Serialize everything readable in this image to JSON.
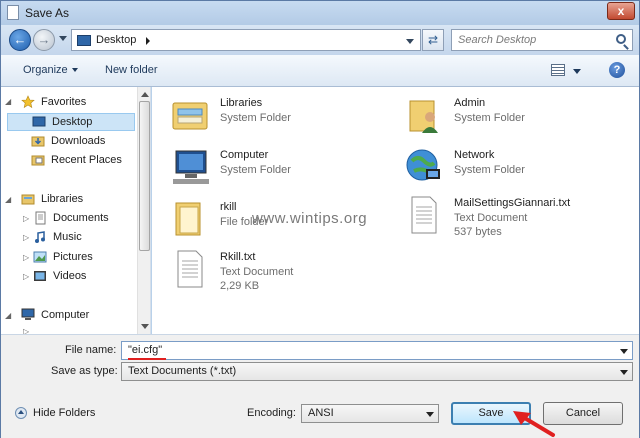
{
  "window": {
    "title": "Save As",
    "close_label": "x"
  },
  "nav": {
    "back_label": "←",
    "forward_label": "→",
    "location": "Desktop",
    "refresh_label": "⇄",
    "search_placeholder": "Search Desktop"
  },
  "toolbar": {
    "organize_label": "Organize",
    "new_folder_label": "New folder",
    "help_label": "?"
  },
  "sidebar": {
    "favorites_label": "Favorites",
    "favorites": [
      {
        "label": "Desktop",
        "icon": "desktop-icon",
        "selected": true
      },
      {
        "label": "Downloads",
        "icon": "downloads-folder-icon"
      },
      {
        "label": "Recent Places",
        "icon": "recent-places-icon"
      }
    ],
    "libraries_label": "Libraries",
    "libraries": [
      {
        "label": "Documents",
        "icon": "documents-icon"
      },
      {
        "label": "Music",
        "icon": "music-icon"
      },
      {
        "label": "Pictures",
        "icon": "pictures-icon"
      },
      {
        "label": "Videos",
        "icon": "videos-icon"
      }
    ],
    "computer_label": "Computer"
  },
  "files": [
    {
      "name": "Libraries",
      "type": "System Folder",
      "size": "",
      "icon": "libraries-icon"
    },
    {
      "name": "Admin",
      "type": "System Folder",
      "size": "",
      "icon": "user-folder-icon"
    },
    {
      "name": "Computer",
      "type": "System Folder",
      "size": "",
      "icon": "computer-icon"
    },
    {
      "name": "Network",
      "type": "System Folder",
      "size": "",
      "icon": "network-icon"
    },
    {
      "name": "rkill",
      "type": "File folder",
      "size": "",
      "icon": "folder-icon"
    },
    {
      "name": "MailSettingsGiannari.txt",
      "type": "Text Document",
      "size": "537 bytes",
      "icon": "text-file-icon"
    },
    {
      "name": "Rkill.txt",
      "type": "Text Document",
      "size": "2,29 KB",
      "icon": "text-file-icon"
    }
  ],
  "watermark": "www.wintips.org",
  "form": {
    "filename_label": "File name:",
    "filename_value": "\"ei.cfg\"",
    "savetype_label": "Save as type:",
    "savetype_value": "Text Documents (*.txt)",
    "encoding_label": "Encoding:",
    "encoding_value": "ANSI",
    "hide_folders_label": "Hide Folders",
    "save_label": "Save",
    "cancel_label": "Cancel"
  },
  "colors": {
    "accent": "#3c7fb1",
    "highlight": "#e02020"
  }
}
